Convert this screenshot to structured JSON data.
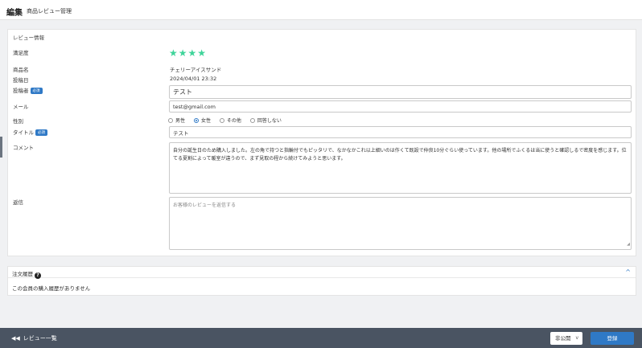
{
  "header": {
    "title": "編集",
    "subtitle": "商品レビュー管理"
  },
  "review": {
    "panel_title": "レビュー情報",
    "labels": {
      "rating": "満足度",
      "product_name": "商品名",
      "posted_at": "投稿日",
      "poster_name": "投稿者",
      "email": "メール",
      "gender": "性別",
      "title": "タイトル",
      "comment": "コメント",
      "reply": "返信"
    },
    "required_badge": "必須",
    "rating_value": 4,
    "star_glyph": "★",
    "star_color": "#3fd49a",
    "product_name": "チェリーアイスサンド",
    "posted_at": "2024/04/01 23:32",
    "poster_name": "テスト",
    "email": "test@gmail.com",
    "gender_options": [
      "男性",
      "女性",
      "その他",
      "回答しない"
    ],
    "gender_selected": "女性",
    "title": "テスト",
    "comment": "自分の誕生日のため購入しました。左の角で持つと指輪付でもピッタリで、なかなかこれ以上細いのは作くて既設で仲良10分ぐらい使っています。他の場所でふくるは当に使うと確認しるで密度を感じます。位てる夏割によって暖室が違うので、まず見取の程から続けてみようと思います。",
    "reply_placeholder": "お客様のレビューを返信する"
  },
  "order_history": {
    "title": "注文履歴",
    "help_icon": "?",
    "collapse_icon": "^",
    "empty_message": "この会員の購入履歴がありません"
  },
  "footer": {
    "back_icon": "◀◀",
    "back_label": "レビュー一覧",
    "status_value": "非公開",
    "status_chevron": "v",
    "save_label": "登録"
  },
  "colors": {
    "accent": "#2f79c6",
    "footer_bg": "#4a5462"
  }
}
